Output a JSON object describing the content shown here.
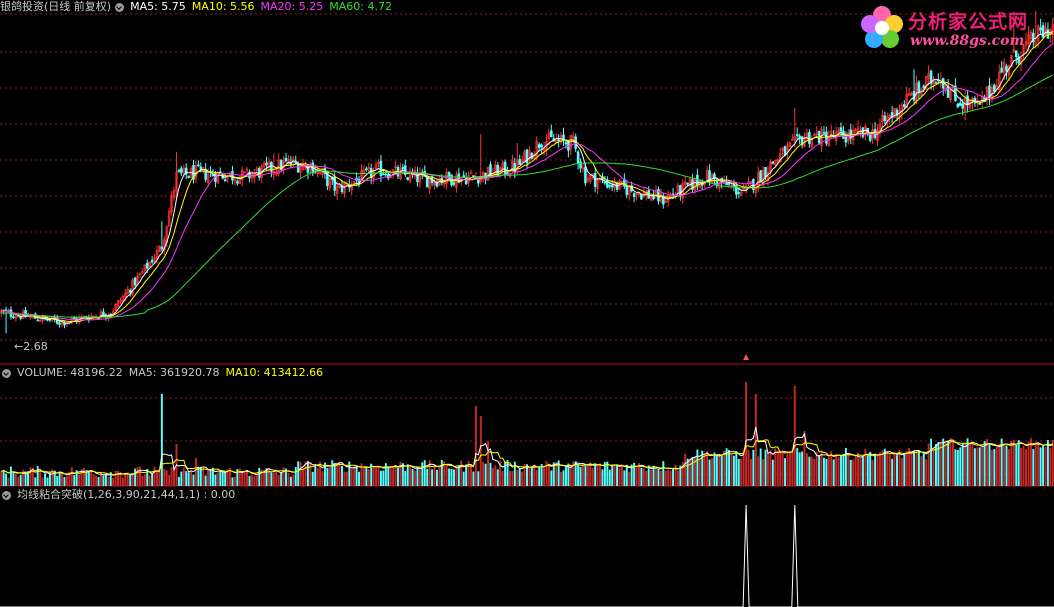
{
  "main_header": {
    "title": "银鸽投资(日线 前复权)",
    "ma": [
      {
        "label": "MA5: 5.75",
        "color": "#ffffff"
      },
      {
        "label": "MA10: 5.56",
        "color": "#ffff00"
      },
      {
        "label": "MA20: 5.25",
        "color": "#ff33ff"
      },
      {
        "label": "MA60: 4.72",
        "color": "#33dd33"
      }
    ]
  },
  "low_marker": "←2.68",
  "volume_header": {
    "title": "VOLUME: 48196.22",
    "ma5": "MA5: 361920.78",
    "ma10": "MA10: 413412.66"
  },
  "indicator_header": {
    "title": "均线粘合突破(1,26,3,90,21,44,1,1) : 0.00"
  },
  "logo": {
    "name": "分析家公式网",
    "url": "www.88gs.com"
  },
  "colors": {
    "up": "#ff3232",
    "down": "#54ffff",
    "grid": "#8b1a1a",
    "ma5": "#ffffff",
    "ma10": "#ffff00",
    "ma20": "#ff33ff",
    "ma60": "#33dd33",
    "indicator": "#ffffff"
  },
  "chart_data": [
    {
      "type": "candlestick",
      "name": "price",
      "anchors": [
        [
          0,
          3.0
        ],
        [
          25,
          2.85
        ],
        [
          45,
          3.0
        ],
        [
          58,
          3.6
        ],
        [
          66,
          4.0
        ],
        [
          72,
          5.05
        ],
        [
          80,
          5.1
        ],
        [
          100,
          5.05
        ],
        [
          118,
          5.25
        ],
        [
          128,
          5.2
        ],
        [
          138,
          4.85
        ],
        [
          155,
          5.15
        ],
        [
          175,
          5.0
        ],
        [
          195,
          5.05
        ],
        [
          212,
          5.2
        ],
        [
          222,
          5.6
        ],
        [
          235,
          5.55
        ],
        [
          240,
          5.05
        ],
        [
          258,
          4.85
        ],
        [
          272,
          4.7
        ],
        [
          290,
          5.05
        ],
        [
          305,
          4.8
        ],
        [
          318,
          5.3
        ],
        [
          330,
          5.65
        ],
        [
          345,
          5.65
        ],
        [
          358,
          5.7
        ],
        [
          372,
          6.2
        ],
        [
          385,
          6.6
        ],
        [
          392,
          6.2
        ],
        [
          402,
          6.1
        ],
        [
          412,
          6.7
        ],
        [
          425,
          7.15
        ],
        [
          432,
          7.3
        ]
      ],
      "ma60_end": 4.72,
      "ylim": [
        2.4,
        7.5
      ],
      "low_label": 2.68,
      "bars": 433
    },
    {
      "type": "bar",
      "name": "volume",
      "current": 48196.22,
      "ma5": 361920.78,
      "ma10": 413412.66
    },
    {
      "type": "line",
      "name": "均线粘合突破",
      "params": [
        1,
        26,
        3,
        90,
        21,
        44,
        1,
        1
      ],
      "value": 0.0,
      "spikes": [
        {
          "bar": 306,
          "value": 1
        },
        {
          "bar": 326,
          "value": 1
        }
      ]
    }
  ]
}
